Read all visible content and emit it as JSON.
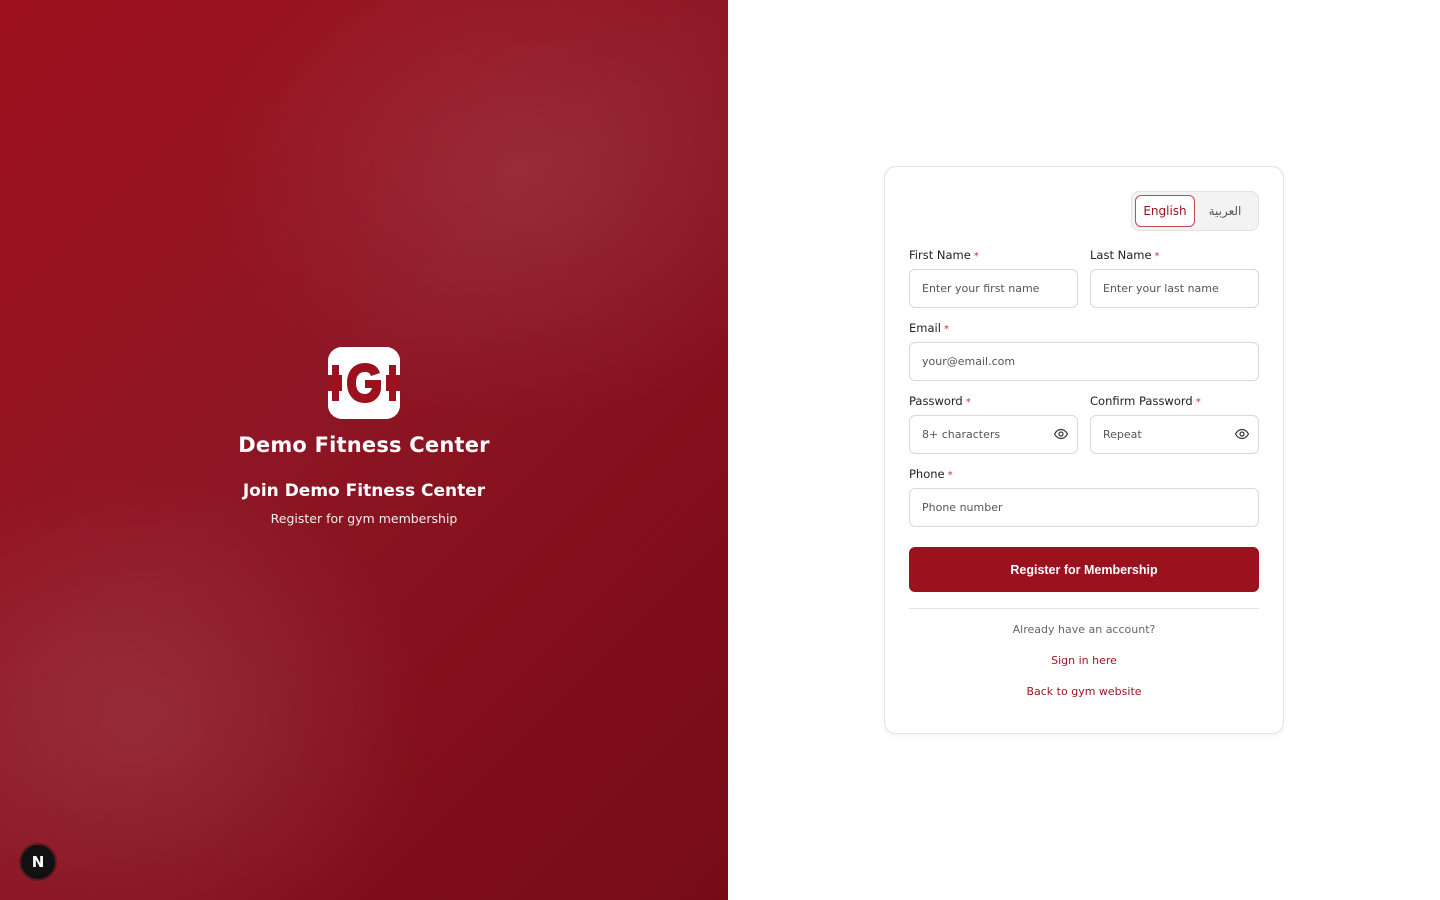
{
  "brand": {
    "name": "Demo Fitness Center",
    "join_title": "Join Demo Fitness Center",
    "join_subtitle": "Register for gym membership"
  },
  "language": {
    "english": "English",
    "arabic": "العربية",
    "selected": "English"
  },
  "form": {
    "first_name": {
      "label": "First Name",
      "required_mark": "*",
      "placeholder": "Enter your first name"
    },
    "last_name": {
      "label": "Last Name",
      "required_mark": "*",
      "placeholder": "Enter your last name"
    },
    "email": {
      "label": "Email",
      "required_mark": "*",
      "placeholder": "your@email.com"
    },
    "password": {
      "label": "Password",
      "required_mark": "*",
      "placeholder": "8+ characters"
    },
    "confirm_password": {
      "label": "Confirm Password",
      "required_mark": "*",
      "placeholder": "Repeat"
    },
    "phone": {
      "label": "Phone",
      "required_mark": "*",
      "placeholder": "Phone number"
    },
    "submit_label": "Register for Membership"
  },
  "footer": {
    "already_text": "Already have an account?",
    "sign_in_link": "Sign in here",
    "back_link": "Back to gym website"
  },
  "dev_badge": {
    "letter": "N"
  },
  "colors": {
    "brand_red": "#9b111e",
    "panel_dark": "#760b16",
    "required": "#c0392b"
  }
}
